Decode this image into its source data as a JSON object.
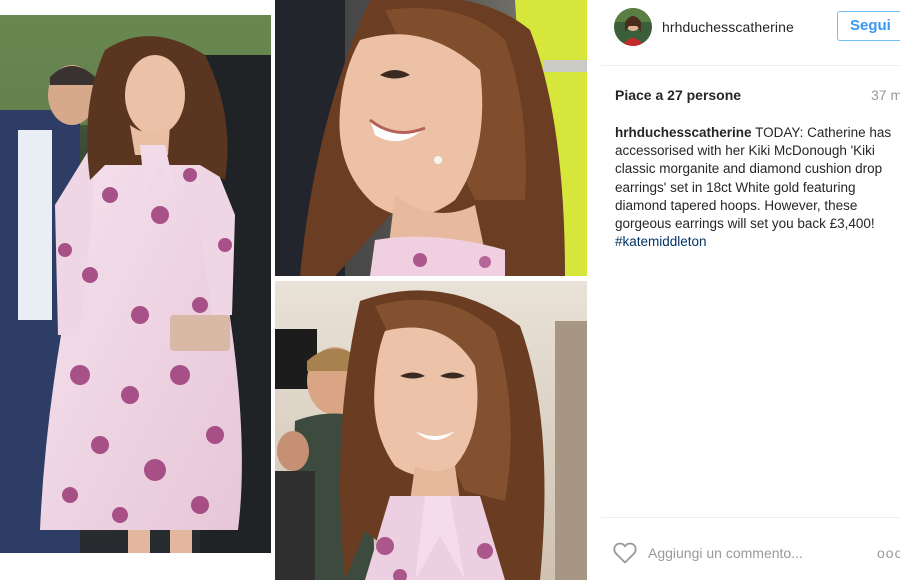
{
  "header": {
    "username": "hrhduchesscatherine",
    "follow_label": "Segui"
  },
  "likes": {
    "text": "Piace a 27 persone",
    "timestamp": "37 m"
  },
  "caption": {
    "author": "hrhduchesscatherine",
    "text": "TODAY: Catherine has accessorised with her Kiki McDonough 'Kiki classic morganite and diamond cushion drop earrings' set in 18ct White gold featuring diamond tapered hoops. However, these gorgeous earrings will set you back £3,400!",
    "hashtag": "#katemiddleton"
  },
  "footer": {
    "comment_placeholder": "Aggiungi un commento...",
    "more_label": "ooo"
  },
  "colors": {
    "follow_blue": "#3897f0",
    "hashtag_blue": "#003569",
    "muted_gray": "#999999",
    "dress_pink": "#f1d7e6",
    "rose_purple": "#9b3a78"
  },
  "icons": {
    "like": "heart-outline-icon",
    "more": "more-options-icon"
  }
}
